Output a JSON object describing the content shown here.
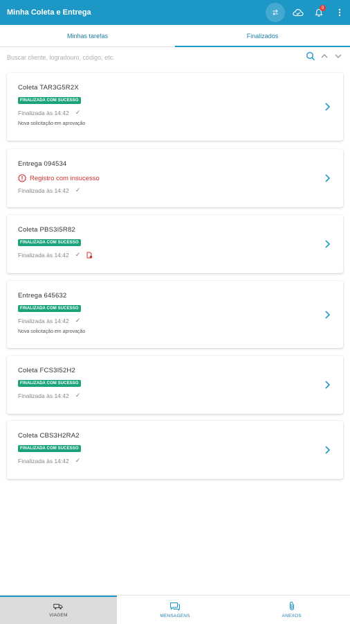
{
  "header": {
    "title": "Minha Coleta e Entrega",
    "notification_count": "9"
  },
  "tabs": [
    {
      "label": "Minhas tarefas"
    },
    {
      "label": "Finalizados"
    }
  ],
  "search": {
    "placeholder": "Buscar cliente, logradouro, código, etc."
  },
  "cards": [
    {
      "title": "Coleta TAR3G5R2X",
      "badge": "FINALIZADA COM SUCESSO",
      "finished": "Finalizada às 14:42",
      "note": "Nova solicitação em aprovação"
    },
    {
      "title": "Entrega 094534",
      "failure": "Registro com insucesso",
      "finished": "Finalizada às 14:42"
    },
    {
      "title": "Coleta PBS3I5R82",
      "badge": "FINALIZADA COM SUCESSO",
      "finished": "Finalizada às 14:42"
    },
    {
      "title": "Entrega 645632",
      "badge": "FINALIZADA COM SUCESSO",
      "finished": "Finalizada às 14:42",
      "note": "Nova solicitação em aprovação"
    },
    {
      "title": "Coleta FCS3I52H2",
      "badge": "FINALIZADA COM SUCESSO",
      "finished": "Finalizada às 14:42"
    },
    {
      "title": "Coleta CBS3H2RA2",
      "badge": "FINALIZADA COM SUCESSO",
      "finished": "Finalizada às 14:42"
    }
  ],
  "bottom_nav": [
    {
      "label": "VIAGEM"
    },
    {
      "label": "MENSAGENS"
    },
    {
      "label": "ANEXOS"
    }
  ],
  "colors": {
    "primary": "#1c97c6",
    "success": "#1aa37a",
    "error": "#d32f2f"
  }
}
